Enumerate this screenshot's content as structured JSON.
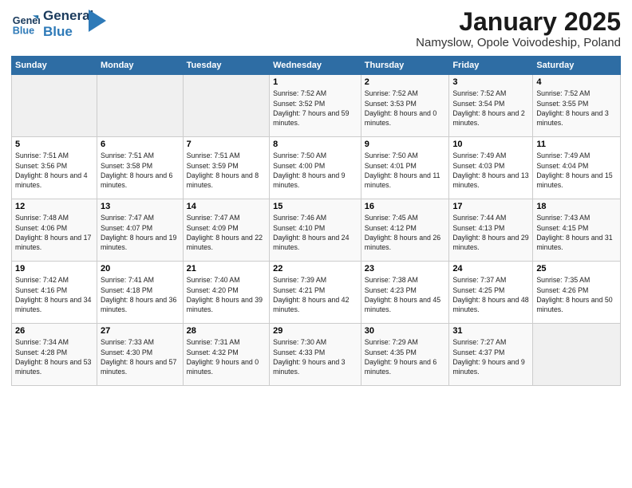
{
  "logo": {
    "line1": "General",
    "line2": "Blue"
  },
  "title": "January 2025",
  "subtitle": "Namyslow, Opole Voivodeship, Poland",
  "headers": [
    "Sunday",
    "Monday",
    "Tuesday",
    "Wednesday",
    "Thursday",
    "Friday",
    "Saturday"
  ],
  "weeks": [
    [
      {
        "num": "",
        "text": ""
      },
      {
        "num": "",
        "text": ""
      },
      {
        "num": "",
        "text": ""
      },
      {
        "num": "1",
        "text": "Sunrise: 7:52 AM\nSunset: 3:52 PM\nDaylight: 7 hours and 59 minutes."
      },
      {
        "num": "2",
        "text": "Sunrise: 7:52 AM\nSunset: 3:53 PM\nDaylight: 8 hours and 0 minutes."
      },
      {
        "num": "3",
        "text": "Sunrise: 7:52 AM\nSunset: 3:54 PM\nDaylight: 8 hours and 2 minutes."
      },
      {
        "num": "4",
        "text": "Sunrise: 7:52 AM\nSunset: 3:55 PM\nDaylight: 8 hours and 3 minutes."
      }
    ],
    [
      {
        "num": "5",
        "text": "Sunrise: 7:51 AM\nSunset: 3:56 PM\nDaylight: 8 hours and 4 minutes."
      },
      {
        "num": "6",
        "text": "Sunrise: 7:51 AM\nSunset: 3:58 PM\nDaylight: 8 hours and 6 minutes."
      },
      {
        "num": "7",
        "text": "Sunrise: 7:51 AM\nSunset: 3:59 PM\nDaylight: 8 hours and 8 minutes."
      },
      {
        "num": "8",
        "text": "Sunrise: 7:50 AM\nSunset: 4:00 PM\nDaylight: 8 hours and 9 minutes."
      },
      {
        "num": "9",
        "text": "Sunrise: 7:50 AM\nSunset: 4:01 PM\nDaylight: 8 hours and 11 minutes."
      },
      {
        "num": "10",
        "text": "Sunrise: 7:49 AM\nSunset: 4:03 PM\nDaylight: 8 hours and 13 minutes."
      },
      {
        "num": "11",
        "text": "Sunrise: 7:49 AM\nSunset: 4:04 PM\nDaylight: 8 hours and 15 minutes."
      }
    ],
    [
      {
        "num": "12",
        "text": "Sunrise: 7:48 AM\nSunset: 4:06 PM\nDaylight: 8 hours and 17 minutes."
      },
      {
        "num": "13",
        "text": "Sunrise: 7:47 AM\nSunset: 4:07 PM\nDaylight: 8 hours and 19 minutes."
      },
      {
        "num": "14",
        "text": "Sunrise: 7:47 AM\nSunset: 4:09 PM\nDaylight: 8 hours and 22 minutes."
      },
      {
        "num": "15",
        "text": "Sunrise: 7:46 AM\nSunset: 4:10 PM\nDaylight: 8 hours and 24 minutes."
      },
      {
        "num": "16",
        "text": "Sunrise: 7:45 AM\nSunset: 4:12 PM\nDaylight: 8 hours and 26 minutes."
      },
      {
        "num": "17",
        "text": "Sunrise: 7:44 AM\nSunset: 4:13 PM\nDaylight: 8 hours and 29 minutes."
      },
      {
        "num": "18",
        "text": "Sunrise: 7:43 AM\nSunset: 4:15 PM\nDaylight: 8 hours and 31 minutes."
      }
    ],
    [
      {
        "num": "19",
        "text": "Sunrise: 7:42 AM\nSunset: 4:16 PM\nDaylight: 8 hours and 34 minutes."
      },
      {
        "num": "20",
        "text": "Sunrise: 7:41 AM\nSunset: 4:18 PM\nDaylight: 8 hours and 36 minutes."
      },
      {
        "num": "21",
        "text": "Sunrise: 7:40 AM\nSunset: 4:20 PM\nDaylight: 8 hours and 39 minutes."
      },
      {
        "num": "22",
        "text": "Sunrise: 7:39 AM\nSunset: 4:21 PM\nDaylight: 8 hours and 42 minutes."
      },
      {
        "num": "23",
        "text": "Sunrise: 7:38 AM\nSunset: 4:23 PM\nDaylight: 8 hours and 45 minutes."
      },
      {
        "num": "24",
        "text": "Sunrise: 7:37 AM\nSunset: 4:25 PM\nDaylight: 8 hours and 48 minutes."
      },
      {
        "num": "25",
        "text": "Sunrise: 7:35 AM\nSunset: 4:26 PM\nDaylight: 8 hours and 50 minutes."
      }
    ],
    [
      {
        "num": "26",
        "text": "Sunrise: 7:34 AM\nSunset: 4:28 PM\nDaylight: 8 hours and 53 minutes."
      },
      {
        "num": "27",
        "text": "Sunrise: 7:33 AM\nSunset: 4:30 PM\nDaylight: 8 hours and 57 minutes."
      },
      {
        "num": "28",
        "text": "Sunrise: 7:31 AM\nSunset: 4:32 PM\nDaylight: 9 hours and 0 minutes."
      },
      {
        "num": "29",
        "text": "Sunrise: 7:30 AM\nSunset: 4:33 PM\nDaylight: 9 hours and 3 minutes."
      },
      {
        "num": "30",
        "text": "Sunrise: 7:29 AM\nSunset: 4:35 PM\nDaylight: 9 hours and 6 minutes."
      },
      {
        "num": "31",
        "text": "Sunrise: 7:27 AM\nSunset: 4:37 PM\nDaylight: 9 hours and 9 minutes."
      },
      {
        "num": "",
        "text": ""
      }
    ]
  ]
}
